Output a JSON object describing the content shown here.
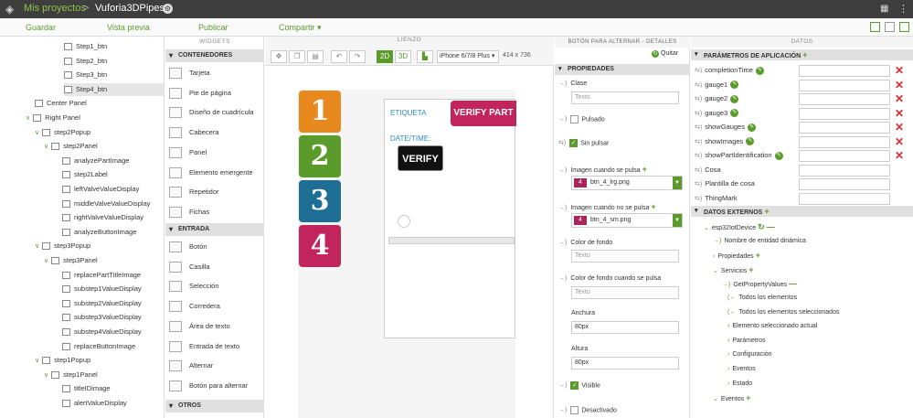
{
  "top": {
    "crumb": "Mis proyectos",
    "sep": ">",
    "project": "Vuforia3DPipes"
  },
  "toolbar": {
    "save": "Guardar",
    "preview": "Vista previa",
    "publish": "Publicar",
    "share": "Compartir ▾"
  },
  "tree": [
    {
      "label": "Step1_btn",
      "indent": 70,
      "chev": false
    },
    {
      "label": "Step2_btn",
      "indent": 70,
      "chev": false
    },
    {
      "label": "Step3_btn",
      "indent": 70,
      "chev": false
    },
    {
      "label": "Step4_btn",
      "indent": 70,
      "chev": false,
      "sel": true
    },
    {
      "label": "Center Panel",
      "indent": 38,
      "chev": false
    },
    {
      "label": "Right Panel",
      "indent": 38,
      "chev": true
    },
    {
      "label": "step2Popup",
      "indent": 48,
      "chev": true
    },
    {
      "label": "step2Panel",
      "indent": 58,
      "chev": true
    },
    {
      "label": "analyzePartImage",
      "indent": 68,
      "chev": false
    },
    {
      "label": "step2Label",
      "indent": 68,
      "chev": false
    },
    {
      "label": "leftValveValueDisplay",
      "indent": 68,
      "chev": false
    },
    {
      "label": "middleValveValueDisplay",
      "indent": 68,
      "chev": false
    },
    {
      "label": "rightValveValueDisplay",
      "indent": 68,
      "chev": false
    },
    {
      "label": "analyzeButtonImage",
      "indent": 68,
      "chev": false
    },
    {
      "label": "step3Popup",
      "indent": 48,
      "chev": true
    },
    {
      "label": "step3Panel",
      "indent": 58,
      "chev": true
    },
    {
      "label": "replacePartTitleImage",
      "indent": 68,
      "chev": false
    },
    {
      "label": "substep1ValueDisplay",
      "indent": 68,
      "chev": false
    },
    {
      "label": "substep2ValueDisplay",
      "indent": 68,
      "chev": false
    },
    {
      "label": "substep3ValueDisplay",
      "indent": 68,
      "chev": false
    },
    {
      "label": "substep4ValueDisplay",
      "indent": 68,
      "chev": false
    },
    {
      "label": "replaceButtonImage",
      "indent": 68,
      "chev": false
    },
    {
      "label": "step1Popup",
      "indent": 48,
      "chev": true
    },
    {
      "label": "step1Panel",
      "indent": 58,
      "chev": true
    },
    {
      "label": "titleIDimage",
      "indent": 68,
      "chev": false
    },
    {
      "label": "alertValueDisplay",
      "indent": 68,
      "chev": false
    }
  ],
  "widgets": {
    "header": "WIDGETS",
    "s1": "CONTENEDORES",
    "c": [
      "Tarjeta",
      "Pie de página",
      "Diseño de cuadrícula",
      "Cabecera",
      "Panel",
      "Elemento emergente",
      "Repetidor",
      "Fichas"
    ],
    "s2": "ENTRADA",
    "e": [
      "Botón",
      "Casilla",
      "Selección",
      "Corredera",
      "Área de texto",
      "Entrada de texto",
      "Alternar",
      "Botón para alternar"
    ],
    "s3": "OTROS"
  },
  "canvas": {
    "header": "LIENZO",
    "b2d": "2D",
    "b3d": "3D",
    "device": "iPhone 6/7/8 Plus ▾",
    "size": "414 x 736",
    "steps": [
      "1",
      "2",
      "3",
      "4"
    ],
    "stepColors": [
      "#e8891d",
      "#5a9b2c",
      "#1f6e96",
      "#c2255c"
    ],
    "etiqueta": "ETIQUETA",
    "verifyPart": "VERIFY PART",
    "datetime": "DATE/TIME:",
    "verify": "VERIFY"
  },
  "props": {
    "header": "BOTÓN PARA ALTERNAR - DETALLES",
    "quit": "Quitar",
    "section": "PROPIEDADES",
    "clase": "Clase",
    "clasePh": "Texto",
    "pulsado": "Pulsado",
    "sinPulsar": "Sin pulsar",
    "imgPulsa": "Imagen cuando se pulsa",
    "imgPulsaVal": "btn_4_lrg.png",
    "imgNoPulsa": "Imagen cuando no se pulsa",
    "imgNoPulsaVal": "btn_4_sm.png",
    "colorFondo": "Color de fondo",
    "colorFondoPh": "Texto",
    "colorFondoP": "Color de fondo cuando se pulsa",
    "colorFondoPPh": "Texto",
    "anchura": "Anchura",
    "anchuraVal": "80px",
    "altura": "Altura",
    "alturaVal": "80px",
    "visible": "Visible",
    "desactivado": "Desactivado"
  },
  "data": {
    "header": "DATOS",
    "app": "PARÁMETROS DE APLICACIÓN",
    "params": [
      {
        "l": "completionTime",
        "pen": true,
        "del": true
      },
      {
        "l": "gauge1",
        "pen": true,
        "del": true
      },
      {
        "l": "gauge2",
        "pen": true,
        "del": true
      },
      {
        "l": "gauge3",
        "pen": true,
        "del": true
      },
      {
        "l": "showGauges",
        "pen": true,
        "del": true
      },
      {
        "l": "showImages",
        "pen": true,
        "del": true
      },
      {
        "l": "showPartIdentification",
        "pen": true,
        "del": true
      },
      {
        "l": "Cosa",
        "pen": false,
        "del": false
      },
      {
        "l": "Plantilla de cosa",
        "pen": false,
        "del": false
      },
      {
        "l": "ThingMark",
        "pen": false,
        "del": false
      }
    ],
    "ext": "DATOS EXTERNOS",
    "extItems": [
      {
        "l": "esp32IotDevice",
        "x": 14,
        "b": "⌄"
      },
      {
        "l": "Nombre de entidad dinámica",
        "x": 24,
        "b": "→)"
      },
      {
        "l": "Propiedades",
        "x": 24,
        "b": "›"
      },
      {
        "l": "Servicios",
        "x": 24,
        "b": "⌄"
      },
      {
        "l": "GetPropertyValues",
        "x": 34,
        "b": "→)"
      },
      {
        "l": "Todos los elementos",
        "x": 40,
        "b": "(←"
      },
      {
        "l": "Todos los elementos seleccionados",
        "x": 40,
        "b": "(←"
      },
      {
        "l": "Elemento seleccionado actual",
        "x": 40,
        "b": "›"
      },
      {
        "l": "Parámetros",
        "x": 40,
        "b": "›"
      },
      {
        "l": "Configuración",
        "x": 40,
        "b": "›"
      },
      {
        "l": "Eventos",
        "x": 40,
        "b": "›"
      },
      {
        "l": "Estado",
        "x": 40,
        "b": "›"
      },
      {
        "l": "Eventos",
        "x": 24,
        "b": "⌄"
      }
    ]
  }
}
